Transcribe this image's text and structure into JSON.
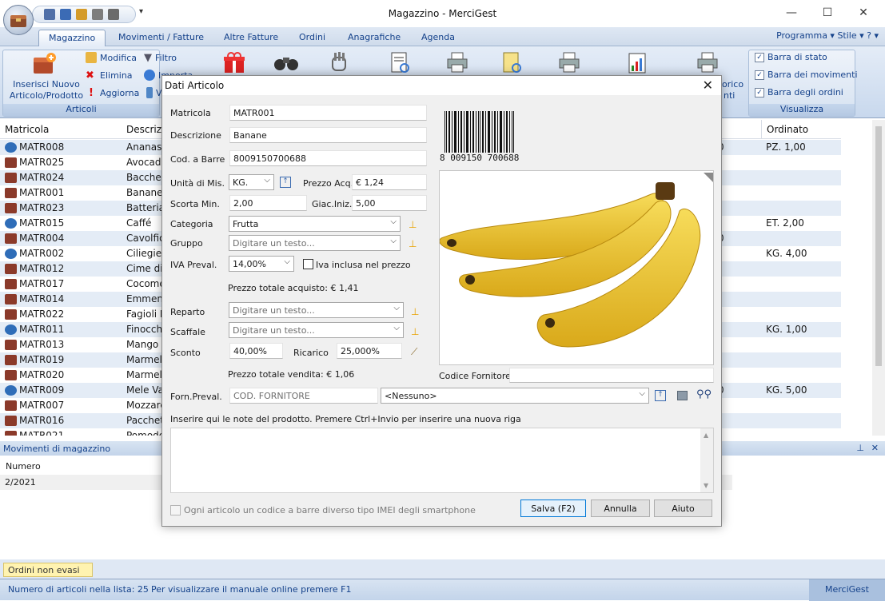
{
  "window": {
    "title": "Magazzino - MerciGest",
    "minimize": "—",
    "maximize": "☐",
    "close": "✕",
    "qat_more": "▾"
  },
  "ribbon": {
    "tabs": [
      "Magazzino",
      "Movimenti / Fatture",
      "Altre Fatture",
      "Ordini",
      "Anagrafiche",
      "Agenda"
    ],
    "right_menu": "Programma  ▾   Stile  ▾   ?  ▾",
    "articoli_group": {
      "label": "Articoli",
      "insert_line1": "Inserisci Nuovo",
      "insert_line2": "Articolo/Prodotto",
      "modifica": "Modifica",
      "elimina": "Elimina",
      "aggiorna": "Aggiorna",
      "filtro": "Filtro",
      "importa": "Importa",
      "visible_peek": "V"
    },
    "hidden_group_peek": {
      "line1": "orico",
      "line2": "nti"
    },
    "visualizza_group": {
      "label": "Visualizza",
      "items": [
        {
          "label": "Barra di stato",
          "checked": true
        },
        {
          "label": "Barra dei movimenti",
          "checked": true
        },
        {
          "label": "Barra degli ordini",
          "checked": true
        }
      ]
    }
  },
  "grid": {
    "headers": {
      "matricola": "Matricola",
      "descrizione": "Descrizi",
      "ordinato": "Ordinato"
    },
    "rows": [
      {
        "code": "MATR008",
        "desc": "Ananas",
        "ordered": "PZ. 1,00",
        "peek": "0",
        "icon": "globe"
      },
      {
        "code": "MATR025",
        "desc": "Avocado",
        "ordered": "",
        "peek": "",
        "icon": "box"
      },
      {
        "code": "MATR024",
        "desc": "Bacchett",
        "ordered": "",
        "peek": "",
        "icon": "box"
      },
      {
        "code": "MATR001",
        "desc": "Banane",
        "ordered": "",
        "peek": "",
        "icon": "box"
      },
      {
        "code": "MATR023",
        "desc": "Batteria",
        "ordered": "",
        "peek": "",
        "icon": "box"
      },
      {
        "code": "MATR015",
        "desc": "Caffé",
        "ordered": "ET. 2,00",
        "peek": "",
        "icon": "globe"
      },
      {
        "code": "MATR004",
        "desc": "Cavolfio",
        "ordered": "",
        "peek": "0",
        "icon": "box"
      },
      {
        "code": "MATR002",
        "desc": "Ciliegie",
        "ordered": "KG. 4,00",
        "peek": "",
        "icon": "globe"
      },
      {
        "code": "MATR012",
        "desc": "Cime di",
        "ordered": "",
        "peek": "",
        "icon": "box"
      },
      {
        "code": "MATR017",
        "desc": "Cocome",
        "ordered": "",
        "peek": "",
        "icon": "box"
      },
      {
        "code": "MATR014",
        "desc": "Emment",
        "ordered": "",
        "peek": "",
        "icon": "box"
      },
      {
        "code": "MATR022",
        "desc": "Fagioli B",
        "ordered": "",
        "peek": "",
        "icon": "box"
      },
      {
        "code": "MATR011",
        "desc": "Finocchi",
        "ordered": "KG. 1,00",
        "peek": "",
        "icon": "globe"
      },
      {
        "code": "MATR013",
        "desc": "Mango",
        "ordered": "",
        "peek": "",
        "icon": "box"
      },
      {
        "code": "MATR019",
        "desc": "Marmell",
        "ordered": "",
        "peek": "",
        "icon": "box"
      },
      {
        "code": "MATR020",
        "desc": "Marmell",
        "ordered": "",
        "peek": "",
        "icon": "box"
      },
      {
        "code": "MATR009",
        "desc": "Mele Val",
        "ordered": "KG. 5,00",
        "peek": "0",
        "icon": "globe"
      },
      {
        "code": "MATR007",
        "desc": "Mozzare",
        "ordered": "",
        "peek": "",
        "icon": "box"
      },
      {
        "code": "MATR016",
        "desc": "Pacchett",
        "ordered": "",
        "peek": "",
        "icon": "box"
      },
      {
        "code": "MATR021",
        "desc": "Pomodo",
        "ordered": "",
        "peek": "",
        "icon": "box"
      }
    ]
  },
  "movimenti": {
    "title": "Movimenti di magazzino",
    "pin": "⊥",
    "close": "✕",
    "header": "Numero",
    "row1": "2/2021"
  },
  "ordini_tab": "Ordini non evasi",
  "status": {
    "count": "Numero di articoli nella lista: 25",
    "help": "Per visualizzare il manuale online premere F1",
    "app": "MerciGest"
  },
  "dialog": {
    "title": "Dati Articolo",
    "close": "✕",
    "matricola_label": "Matricola",
    "matricola": "MATR001",
    "descrizione_label": "Descrizione",
    "descrizione": "Banane",
    "barcode_label": "Cod. a Barre",
    "barcode": "8009150700688",
    "barcode_digits": "8 009150 700688",
    "unita_label": "Unità di Mis.",
    "unita": "KG.",
    "prezzo_acq_label": "Prezzo Acq.",
    "prezzo_acq": "€ 1,24",
    "scorta_label": "Scorta Min.",
    "scorta": "2,00",
    "giac_label": "Giac.Iniz.",
    "giac": "5,00",
    "categoria_label": "Categoria",
    "categoria": "Frutta",
    "gruppo_label": "Gruppo",
    "gruppo_placeholder": "Digitare un testo...",
    "iva_label": "IVA Preval.",
    "iva": "14,00%",
    "iva_inclusa_label": "Iva inclusa nel prezzo",
    "iva_inclusa": false,
    "totale_acquisto": "Prezzo totale acquisto: € 1,41",
    "reparto_label": "Reparto",
    "reparto_placeholder": "Digitare un testo...",
    "scaffale_label": "Scaffale",
    "scaffale_placeholder": "Digitare un testo...",
    "sconto_label": "Sconto",
    "sconto": "40,00%",
    "ricarico_label": "Ricarico",
    "ricarico": "25,000%",
    "totale_vendita": "Prezzo totale vendita: € 1,06",
    "codice_fornitore_label": "Codice Fornitore",
    "codice_fornitore": "",
    "forn_label": "Forn.Preval.",
    "forn_code_placeholder": "COD. FORNITORE",
    "forn_select": "<Nessuno>",
    "notes_hint": "Inserire qui le note del prodotto. Premere Ctrl+Invio per inserire una nuova riga",
    "imei_label": "Ogni articolo un codice a barre diverso tipo IMEI degli smartphone",
    "imei": false,
    "save_button": "Salva (F2)",
    "cancel_button": "Annulla",
    "help_button": "Aiuto"
  }
}
